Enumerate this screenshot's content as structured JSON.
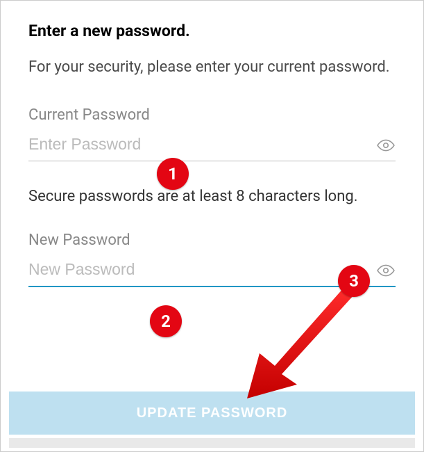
{
  "title": "Enter a new password.",
  "subtitle": "For your security, please enter your current password.",
  "currentPassword": {
    "label": "Current Password",
    "placeholder": "Enter Password"
  },
  "hint": "Secure passwords are at least 8 characters long.",
  "newPassword": {
    "label": "New Password",
    "placeholder": "New Password"
  },
  "button": "UPDATE PASSWORD",
  "annotations": {
    "badge1": "1",
    "badge2": "2",
    "badge3": "3"
  }
}
